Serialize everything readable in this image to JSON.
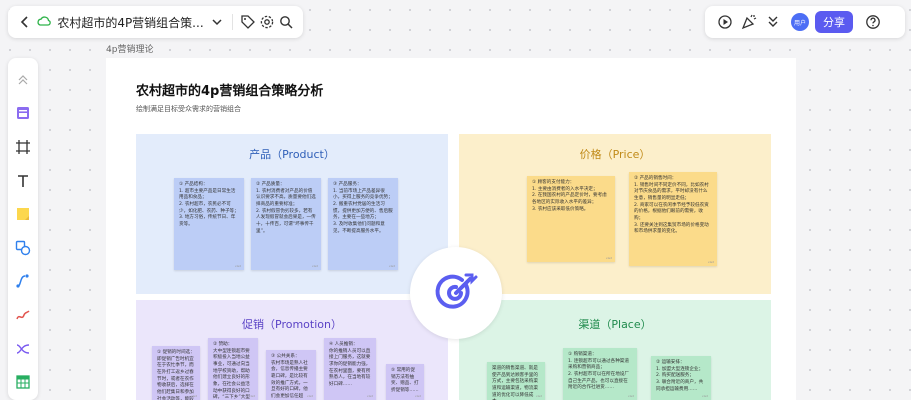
{
  "toolbar": {
    "doc_title": "农村超市的4P营销组合策...",
    "share_label": "分享",
    "user_label": "用户"
  },
  "breadcrumb": "4p营销理论",
  "canvas": {
    "title": "农村超市的4p营销组合策略分析",
    "subtitle": "绘制满足目标受众需求的营销组合"
  },
  "quadrants": {
    "product": {
      "title": "产品（Product）",
      "notes": [
        "① 产品结构：\n1. 超市主要产品是日常生活用品和食品；\n2. 农村超市，农民必不可少，如化肥、农药、种子等；\n3. 地方习俗，传统节日、年货等。",
        "② 产品质量：\n1. 农村消费者对产品的价值认识要求不高，质量要他们选择商品的重要标准；\n2. 农村假冒伪劣较多，若有人发现假冒就会后果是，一传十，十传百，可谓“坏事传千里”。",
        "③ 产品服务：\n1. 当前市场上产品差异很小，买得上服务的竞争优势；\n2. 搬重农村党居的生活习惯，提供更加方便的、售后服务，主要在一些地方；\n3. 及时收集他们问题和意见，不断提高服务水平。"
      ]
    },
    "price": {
      "title": "价格（Price）",
      "notes": [
        "① 顾客的支付能力：\n1. 主要由消费者的入水平决定；\n2. 在我国农村的产品定价时，要考虑各地区的实际收入水平的差异；\n3. 农村应该采取低价策略。",
        "② 产品的销售时间：\n1. 销售时间不同定价不同，比如农村对节庆食品的需求，平时却没有什么生意，销售量的明显走低；\n2. 商家可以在农闲季节经予较低农资的价格，根据他们眼前的需要，收购；\n3. 还要关注到这集贸市场的价格变动和市场供求量的变化。"
      ]
    },
    "promotion": {
      "title": "促销（Promotion）",
      "notes": [
        "① 促销的时间选：\n即促销广告时机宜在于农忙季节，而在外打工返乡过春节时，或者在农作物收获后，选择在他们赶集日和参加社会活动等，能较好地说明。",
        "② 赞助：\n大中型连锁超市要积极投入当地公益事业，可通过向当地学校资助，帮助他们建立良好的形象，在社会公益活动中获得良好的口碑，“三下乡”大型活动……",
        "③ 公共关系：\n农村市场是熟人社会，信息传播主要靠口碑，是比较有效的推广方式，一旦有好的口碑，他们会更加信任超市……",
        "④ 人员推销：\n你的推销人员可以直接上门服务，这就要求你的促销能力强，在农村里面，要有所熟悉人，在当地有较好口碑……",
        "⑤ 常用的促销方法有抽奖、赠品、打折促销等……"
      ]
    },
    "place": {
      "title": "渠道（Place）",
      "notes": [
        "渠道的销售渠道、就是使产品到达顾客手里的方式，主要包括采购渠道和运输渠道，物流渠道的优化可以降低成本……",
        "① 购销渠道：\n1. 连锁超市可以通过各种渠道采购和营销商品；\n2. 农村超市可以在所在地设厂自己生产产品，也可以直接在附近的合作社进货……",
        "② 运输安排：\n1. 加盟大型连锁企业；\n2. 购买配送服务；\n3. 联合附近的商户，共同承担运输费用……"
      ]
    }
  }
}
